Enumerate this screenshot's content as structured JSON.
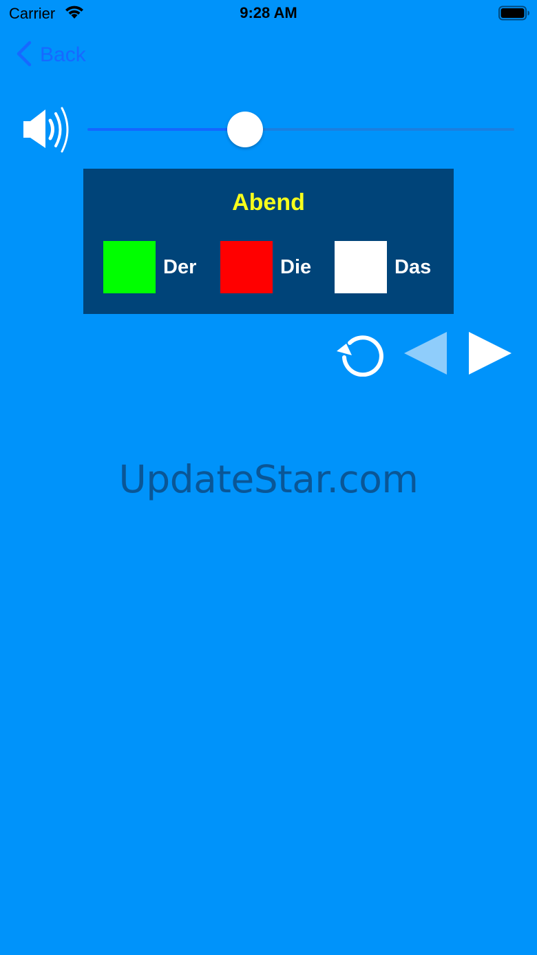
{
  "status_bar": {
    "carrier": "Carrier",
    "time": "9:28 AM",
    "wifi_icon": "wifi-icon",
    "battery_icon": "battery-icon"
  },
  "nav": {
    "back_label": "Back",
    "back_icon": "chevron-left-icon"
  },
  "volume": {
    "icon": "speaker-icon",
    "level": 0.37
  },
  "card": {
    "word": "Abend",
    "word_color": "#f7ff1c",
    "background": "#004479",
    "articles": [
      {
        "label": "Der",
        "color": "#00ff00"
      },
      {
        "label": "Die",
        "color": "#ff0000"
      },
      {
        "label": "Das",
        "color": "#ffffff"
      }
    ]
  },
  "controls": {
    "replay_icon": "replay-icon",
    "previous_icon": "previous-triangle-icon",
    "next_icon": "next-triangle-icon"
  },
  "watermark": "UpdateStar.com",
  "colors": {
    "background": "#0093fa",
    "accent": "#1769ff"
  }
}
